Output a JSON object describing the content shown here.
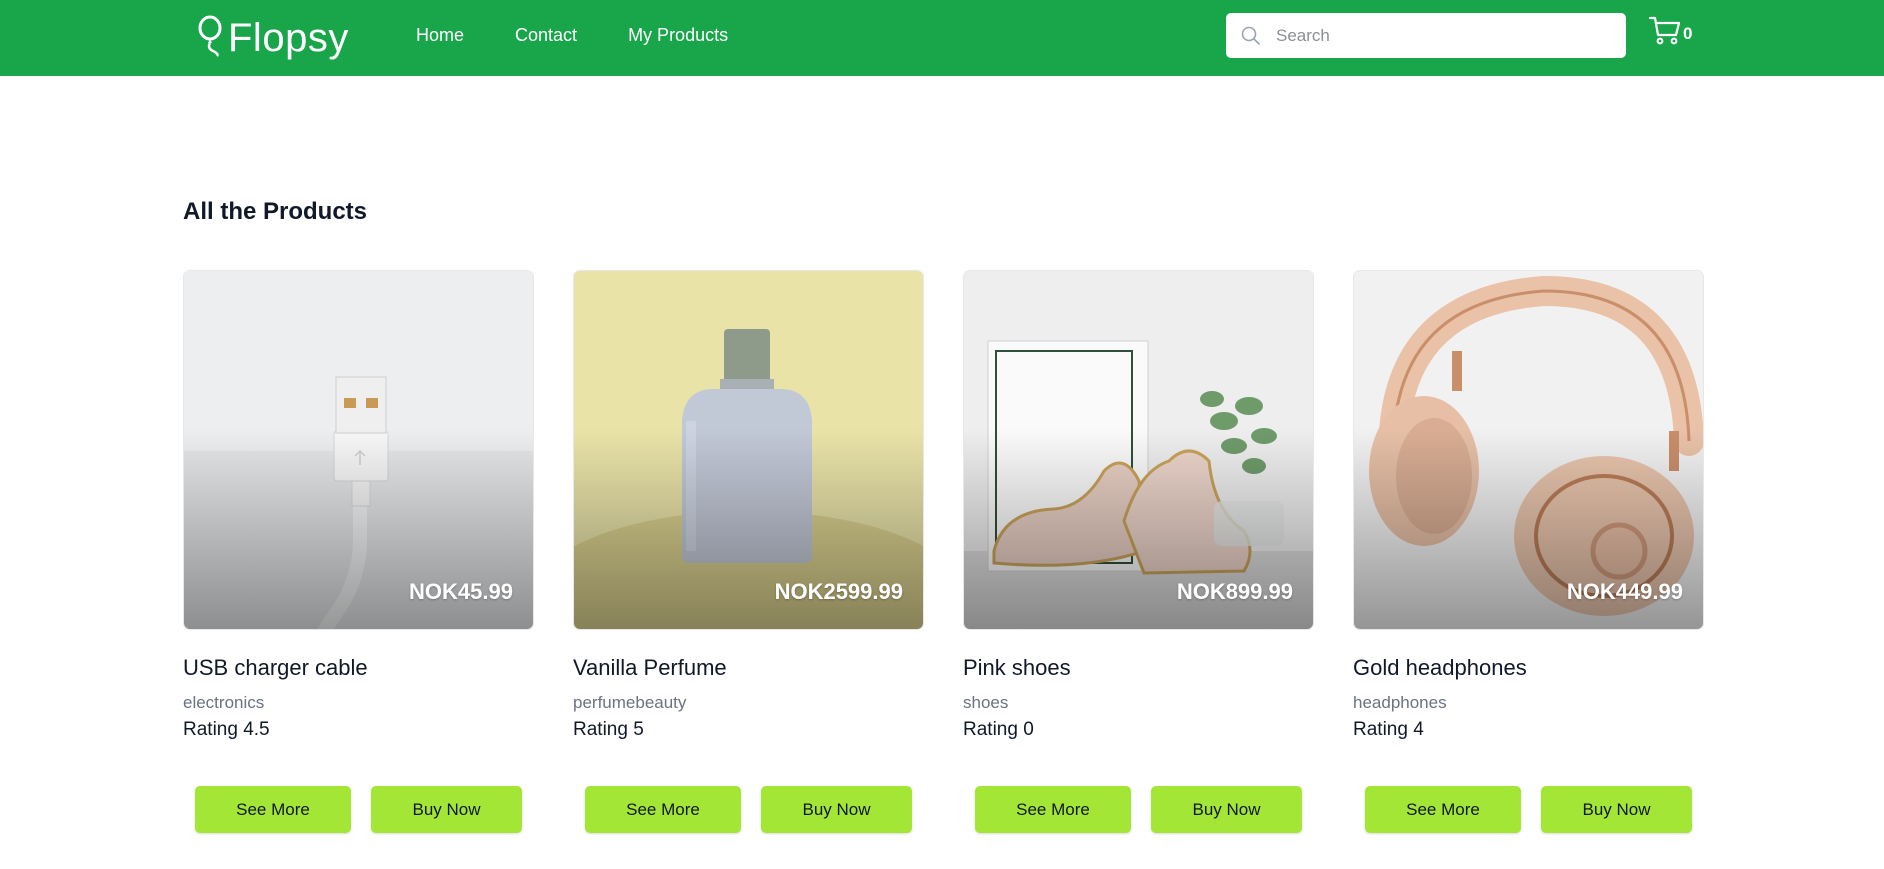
{
  "header": {
    "logo_text": "Flopsy",
    "nav": [
      "Home",
      "Contact",
      "My Products"
    ],
    "search_placeholder": "Search",
    "cart_count": "0",
    "brand_color": "#19a64b"
  },
  "main": {
    "title": "All the Products",
    "products": [
      {
        "name": "USB charger cable",
        "category": "electronics",
        "rating": "Rating 4.5",
        "price": "NOK45.99",
        "see_more": "See More",
        "buy_now": "Buy Now"
      },
      {
        "name": "Vanilla Perfume",
        "category": "perfumebeauty",
        "rating": "Rating 5",
        "price": "NOK2599.99",
        "see_more": "See More",
        "buy_now": "Buy Now"
      },
      {
        "name": "Pink shoes",
        "category": "shoes",
        "rating": "Rating 0",
        "price": "NOK899.99",
        "see_more": "See More",
        "buy_now": "Buy Now"
      },
      {
        "name": "Gold headphones",
        "category": "headphones",
        "rating": "Rating 4",
        "price": "NOK449.99",
        "see_more": "See More",
        "buy_now": "Buy Now"
      }
    ],
    "button_color": "#a3e635"
  },
  "icons": [
    "balloon-logo-icon",
    "search-icon",
    "cart-icon"
  ]
}
